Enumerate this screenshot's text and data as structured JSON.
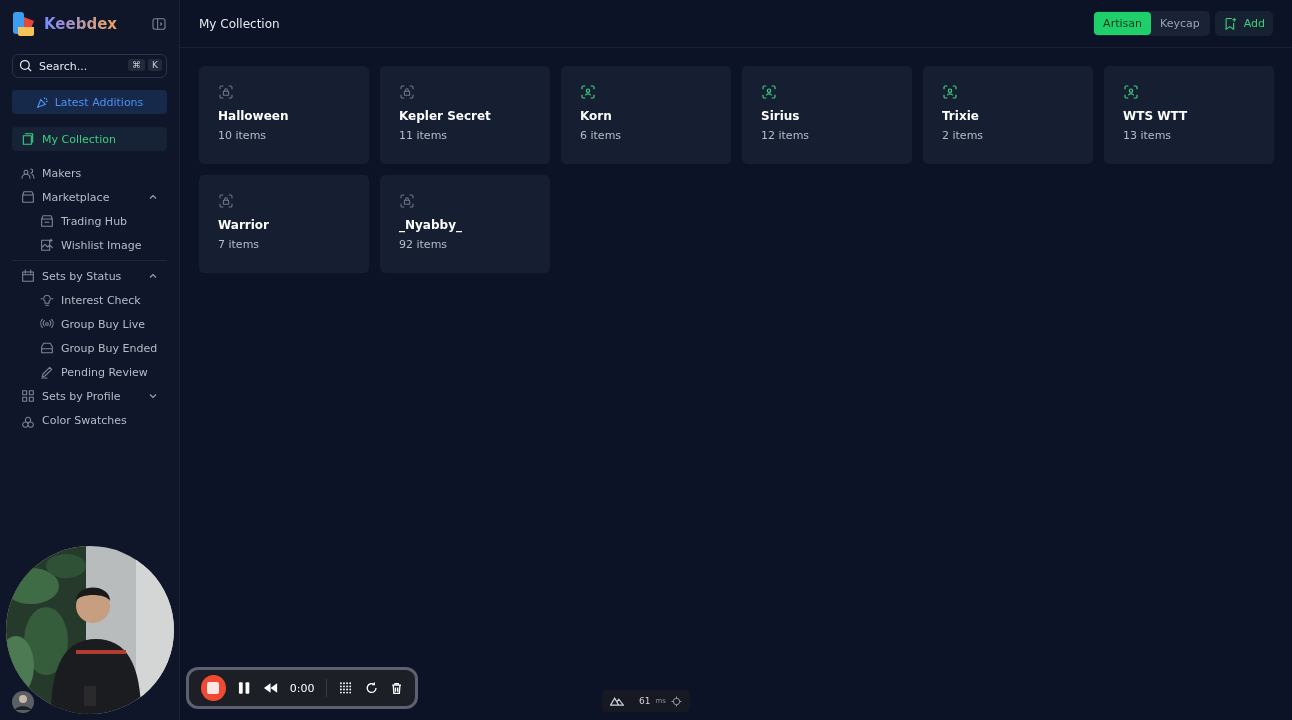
{
  "app": {
    "name": "Keebdex"
  },
  "search": {
    "placeholder": "Search...",
    "shortcut": [
      "⌘",
      "K"
    ]
  },
  "latest_button": {
    "label": "Latest Additions"
  },
  "nav": [
    {
      "label": "My Collection",
      "selected": true
    },
    {
      "label": "Makers",
      "selected": false
    },
    {
      "label": "Marketplace",
      "selected": false,
      "expanded": true,
      "children": [
        {
          "label": "Trading Hub",
          "selected": false
        },
        {
          "label": "Wishlist Image",
          "selected": false
        }
      ]
    },
    {
      "label": "Sets by Status",
      "selected": false,
      "expanded": true,
      "children": [
        {
          "label": "Interest Check",
          "selected": false
        },
        {
          "label": "Group Buy Live",
          "selected": false
        },
        {
          "label": "Group Buy Ended",
          "selected": false
        },
        {
          "label": "Pending Review",
          "selected": false
        }
      ]
    },
    {
      "label": "Sets by Profile",
      "selected": false,
      "expanded": false
    },
    {
      "label": "Color Swatches",
      "selected": false
    }
  ],
  "header": {
    "title": "My Collection",
    "toggle": [
      {
        "label": "Artisan",
        "selected": true
      },
      {
        "label": "Keycap",
        "selected": false
      }
    ],
    "add_button": "Add"
  },
  "cards": [
    {
      "name": "Halloween",
      "count": "10 items",
      "locked": true
    },
    {
      "name": "Kepler Secret",
      "count": "11 items",
      "locked": true
    },
    {
      "name": "Korn",
      "count": "6 items",
      "locked": false
    },
    {
      "name": "Sirius",
      "count": "12 items",
      "locked": false
    },
    {
      "name": "Trixie",
      "count": "2 items",
      "locked": false
    },
    {
      "name": "WTS WTT",
      "count": "13 items",
      "locked": false
    },
    {
      "name": "Warrior",
      "count": "7 items",
      "locked": true
    },
    {
      "name": "_Nyabby_",
      "count": "92 items",
      "locked": true
    }
  ],
  "recorder": {
    "time": "0:00"
  },
  "perf": {
    "reading": "61",
    "unit": "ms"
  }
}
